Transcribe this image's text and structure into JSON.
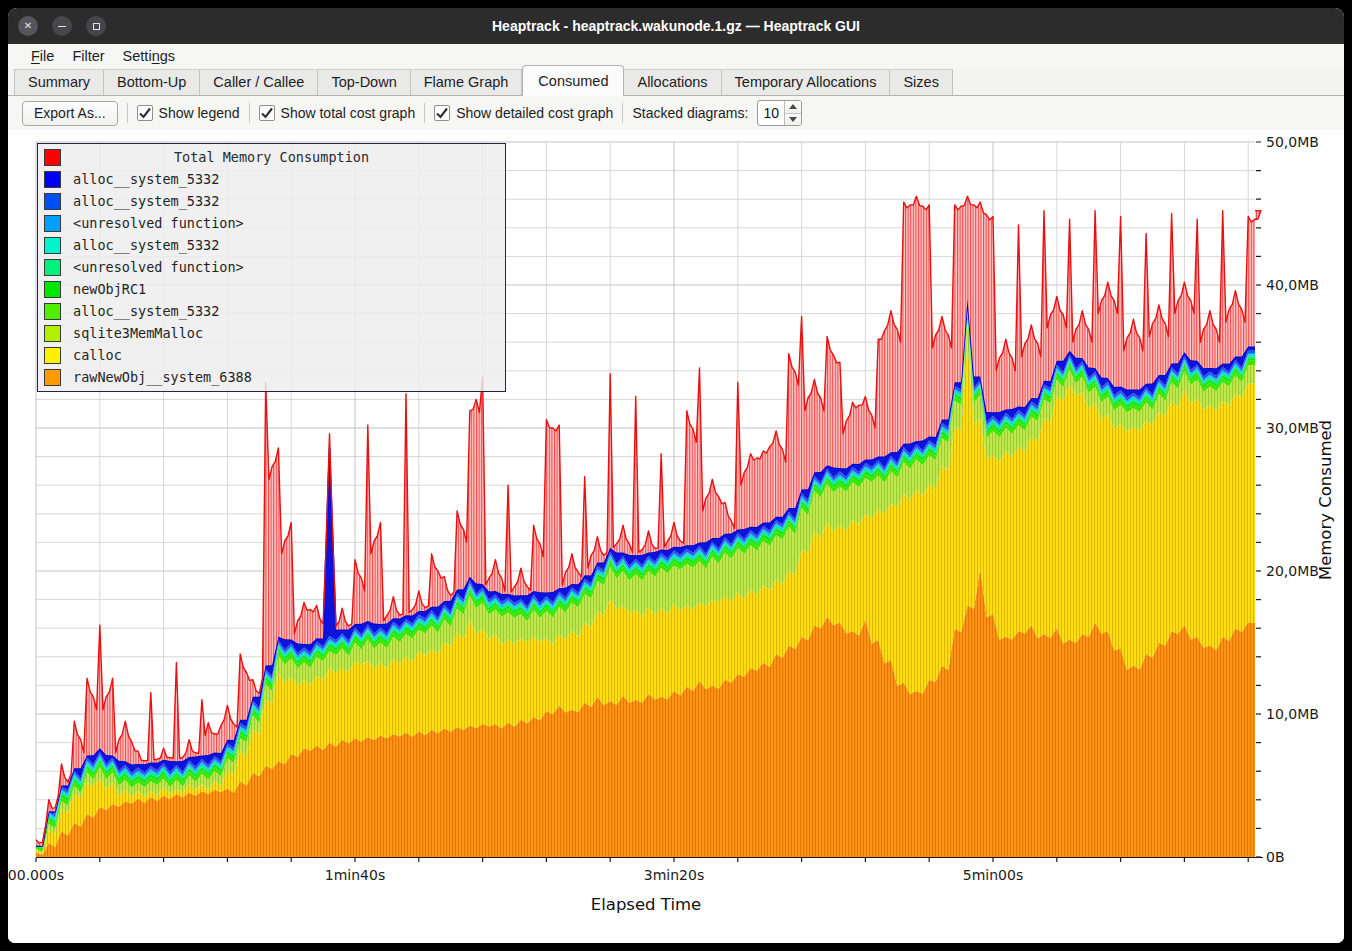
{
  "window": {
    "title": "Heaptrack - heaptrack.wakunode.1.gz — Heaptrack GUI"
  },
  "menubar": {
    "items": [
      {
        "label": "File",
        "mnemonic": "F"
      },
      {
        "label": "Filter",
        "mnemonic": ""
      },
      {
        "label": "Settings",
        "mnemonic": "n"
      }
    ]
  },
  "tabs": {
    "items": [
      "Summary",
      "Bottom-Up",
      "Caller / Callee",
      "Top-Down",
      "Flame Graph",
      "Consumed",
      "Allocations",
      "Temporary Allocations",
      "Sizes"
    ],
    "active": "Consumed"
  },
  "toolbar": {
    "export_label": "Export As...",
    "checkboxes": [
      {
        "label": "Show legend",
        "checked": true
      },
      {
        "label": "Show total cost graph",
        "checked": true
      },
      {
        "label": "Show detailed cost graph",
        "checked": true
      }
    ],
    "stacked_label": "Stacked diagrams:",
    "stacked_value": "10"
  },
  "chart_data": {
    "type": "area",
    "xlabel": "Elapsed Time",
    "ylabel": "Memory Consumed",
    "ylim": [
      0,
      50
    ],
    "t_step": 4,
    "x_ticks": [
      {
        "t": 0,
        "label": "00.000s"
      },
      {
        "t": 100,
        "label": "1min40s"
      },
      {
        "t": 200,
        "label": "3min20s"
      },
      {
        "t": 300,
        "label": "5min00s"
      }
    ],
    "y_ticks": [
      {
        "mb": 0,
        "label": "0B"
      },
      {
        "mb": 10,
        "label": "10,0MB"
      },
      {
        "mb": 20,
        "label": "20,0MB"
      },
      {
        "mb": 30,
        "label": "30,0MB"
      },
      {
        "mb": 40,
        "label": "40,0MB"
      },
      {
        "mb": 50,
        "label": "50,0MB"
      }
    ],
    "grid": {
      "x_every_s": 20,
      "y_every_mb": 2,
      "minor_color": "#d7d7d7",
      "major_color": "#c3c3c3"
    },
    "legend": {
      "title": "Total Memory Consumption",
      "title_color": "#ff0000",
      "items": [
        {
          "label": "alloc__system_5332",
          "color": "#0000f5"
        },
        {
          "label": "alloc__system_5332",
          "color": "#0050f5"
        },
        {
          "label": "<unresolved function>",
          "color": "#00a0ff"
        },
        {
          "label": "alloc__system_5332",
          "color": "#00f5cd"
        },
        {
          "label": "<unresolved function>",
          "color": "#00f07d"
        },
        {
          "label": "newObjRC1",
          "color": "#00e600"
        },
        {
          "label": "alloc__system_5332",
          "color": "#50ef00"
        },
        {
          "label": "sqlite3MemMalloc",
          "color": "#b4ef00"
        },
        {
          "label": "calloc",
          "color": "#ffef00"
        },
        {
          "label": "rawNewObj__system_6388",
          "color": "#ff9b00"
        }
      ]
    },
    "series": [
      {
        "name": "rawNewObj__system_6388",
        "kind": "area",
        "color": "#ff9417",
        "stripe": "#e07800",
        "detail_dip": 0.3,
        "top": [
          0.3,
          1,
          1.8,
          2.4,
          3,
          3.5,
          3.7,
          3.9,
          4.1,
          4.2,
          4.3,
          4.4,
          4.5,
          4.6,
          4.7,
          4.8,
          5.3,
          5.9,
          6.4,
          6.7,
          7.2,
          7.6,
          7.8,
          8,
          8.2,
          8.3,
          8.4,
          8.5,
          8.6,
          8.7,
          8.8,
          8.9,
          9,
          9.1,
          9.2,
          9.3,
          9.3,
          9.4,
          9.6,
          9.8,
          10.2,
          10.6,
          10.3,
          10.8,
          11.2,
          10.9,
          11.3,
          11,
          11.4,
          11.2,
          11.6,
          11.9,
          12.3,
          12,
          12.4,
          12.8,
          13.2,
          13.6,
          14.2,
          14.8,
          15.4,
          16.2,
          16.8,
          16.4,
          15.8,
          16.6,
          15.2,
          13.8,
          12.2,
          11.6,
          12.4,
          13.4,
          16,
          17.6,
          20.2,
          17,
          15.4,
          15.8,
          16.2,
          15.6,
          16,
          15.2,
          15.6,
          16.4,
          15.8,
          14.6,
          13.4,
          14.2,
          15,
          15.8,
          16.2,
          15.4,
          14.8,
          15.4,
          16,
          16.4
        ]
      },
      {
        "name": "calloc",
        "kind": "area",
        "color": "#ffdf12",
        "stripe": "#ddb800",
        "detail_dip": 0.45,
        "top": [
          0.5,
          1.9,
          3.4,
          4.4,
          5.2,
          5.5,
          5.2,
          4.7,
          4.6,
          4.6,
          4.9,
          4.7,
          5.1,
          5.1,
          5.3,
          6.1,
          7.4,
          8.9,
          11,
          12.9,
          12.6,
          12.4,
          12.7,
          13.2,
          13.2,
          13.7,
          13.7,
          13.6,
          13.9,
          14,
          14.4,
          14.5,
          15,
          15.7,
          16.6,
          16,
          15.6,
          15.2,
          15.3,
          15.4,
          15.3,
          15.6,
          15.8,
          16.4,
          17.2,
          18.1,
          17.6,
          17.3,
          17.5,
          17.4,
          17.7,
          17.6,
          17.8,
          18,
          18.3,
          18.5,
          18.7,
          19,
          19.4,
          20,
          21.5,
          22.8,
          23.4,
          23.2,
          23.6,
          24,
          24.3,
          24.7,
          25.4,
          25.7,
          26.1,
          27.4,
          30.1,
          36,
          30.6,
          28.1,
          28.4,
          28.7,
          29.4,
          30.7,
          32.2,
          33,
          32.5,
          31.8,
          31,
          30.3,
          30.1,
          30.5,
          31.1,
          31.9,
          32.7,
          32.1,
          31.6,
          31.9,
          32.4,
          33.1
        ]
      },
      {
        "name": "sqlite3MemMalloc",
        "kind": "area",
        "color": "#c3e950",
        "stripe": "#9acb2e",
        "detail_dip": 0.5,
        "top": [
          0.6,
          2.3,
          3.9,
          5,
          5.9,
          6.3,
          5.9,
          5.4,
          5.2,
          5.3,
          5.5,
          5.4,
          5.7,
          5.8,
          6,
          6.9,
          8.3,
          9.9,
          12.1,
          14.1,
          13.9,
          13.6,
          14,
          14.4,
          14.6,
          15,
          15.2,
          15,
          15.4,
          15.6,
          15.9,
          16.2,
          16.6,
          17.4,
          18.3,
          17.8,
          17.3,
          17.1,
          17,
          17.3,
          17.2,
          17.5,
          17.8,
          18.4,
          19.3,
          20.3,
          20,
          19.8,
          20,
          20.2,
          20.4,
          20.5,
          20.7,
          21,
          21.3,
          21.6,
          21.8,
          22.1,
          22.5,
          23.1,
          24.4,
          25.6,
          26.1,
          25.9,
          26.2,
          26.5,
          26.7,
          27,
          27.6,
          27.8,
          28.1,
          29.3,
          31.9,
          37.7,
          32.3,
          29.8,
          30,
          30.2,
          30.8,
          32,
          33.4,
          34.1,
          33.6,
          32.9,
          32.2,
          31.6,
          31.4,
          31.8,
          32.4,
          33.2,
          34,
          33.4,
          32.9,
          33.2,
          33.7,
          34.4
        ]
      },
      {
        "name": "alloc__system_5332",
        "kind": "sliver",
        "color": "#3ce600",
        "thickness": 0.3
      },
      {
        "name": "newObjRC1",
        "kind": "sliver",
        "color": "#0ae60a",
        "thickness": 0.18
      },
      {
        "name": "<unresolved function>",
        "kind": "sliver",
        "color": "#00e87d",
        "thickness": 0.12
      },
      {
        "name": "alloc__system_5332",
        "kind": "sliver",
        "color": "#00e0c3",
        "thickness": 0.15
      },
      {
        "name": "<unresolved function>",
        "kind": "sliver",
        "color": "#00a5ff",
        "thickness": 0.1
      },
      {
        "name": "alloc__system_5332",
        "kind": "sliver",
        "color": "#2d50f0",
        "thickness": 0.2
      },
      {
        "name": "alloc__system_5332",
        "kind": "area",
        "color": "#0a14dc",
        "stroke": "#0000c8",
        "stroke_w": 1.7,
        "detail_dip": 0.12,
        "top": [
          0.8,
          3.2,
          5,
          6.2,
          7.1,
          7.6,
          7.1,
          6.7,
          6.5,
          6.6,
          6.8,
          6.7,
          7,
          7.1,
          7.3,
          8.2,
          9.6,
          11.2,
          13.4,
          15.4,
          15.2,
          14.9,
          15.3,
          28.6,
          15.9,
          16.3,
          16.5,
          16.3,
          16.7,
          16.9,
          17.2,
          17.5,
          17.9,
          18.7,
          19.6,
          19.1,
          18.6,
          18.4,
          18.3,
          18.6,
          18.5,
          18.8,
          19.1,
          19.7,
          20.6,
          21.6,
          21.3,
          21.1,
          21.3,
          21.5,
          21.7,
          21.8,
          22,
          22.3,
          22.6,
          22.9,
          23.1,
          23.4,
          23.8,
          24.4,
          25.7,
          26.9,
          27.4,
          27.2,
          27.5,
          27.8,
          28,
          28.3,
          28.9,
          29.1,
          29.4,
          30.6,
          33.2,
          39,
          33.6,
          31.1,
          31.3,
          31.5,
          32.1,
          33.3,
          34.7,
          35.4,
          34.9,
          34.2,
          33.5,
          32.9,
          32.7,
          33.1,
          33.7,
          34.5,
          35.3,
          34.7,
          34.2,
          34.5,
          35,
          35.7
        ]
      },
      {
        "name": "Total Memory Consumption",
        "kind": "area",
        "color": "#ffc9c9",
        "stripe": "#f04848",
        "stroke": "#e81010",
        "stroke_w": 1.4,
        "red_detail": true,
        "top": [
          1.2,
          4,
          6.5,
          9.5,
          12.5,
          16.2,
          12.5,
          9.5,
          7.4,
          11.5,
          7.6,
          13.6,
          8.2,
          11,
          8.6,
          10.6,
          14.2,
          12.4,
          33.2,
          28.6,
          23.4,
          17.8,
          17.6,
          29.6,
          17.4,
          20.8,
          30.2,
          23.4,
          18.2,
          32.4,
          18.6,
          21.2,
          19.6,
          24.2,
          31.2,
          33.6,
          20.8,
          26,
          20.2,
          23.2,
          30.6,
          30.2,
          21.2,
          26.6,
          22.4,
          33.8,
          23.2,
          32.2,
          22.8,
          28.2,
          23.4,
          31.2,
          34.2,
          26.4,
          24.8,
          33.2,
          28.2,
          28.4,
          29.8,
          35.2,
          37.8,
          33.4,
          36.4,
          34.6,
          31.8,
          32.2,
          36.2,
          38.2,
          45.8,
          46.2,
          45.6,
          37.8,
          45.6,
          46.2,
          45.8,
          44.8,
          36.2,
          44.2,
          37.2,
          45.2,
          39.2,
          44.6,
          38.2,
          45.2,
          40.2,
          44.8,
          37.6,
          43.6,
          38.6,
          45,
          40.2,
          44.6,
          38.2,
          45.2,
          39.6,
          44.8,
          45.2
        ]
      }
    ]
  }
}
